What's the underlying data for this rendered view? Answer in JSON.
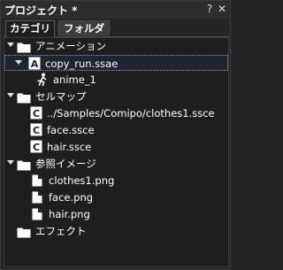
{
  "panel": {
    "title": "プロジェクト *",
    "help_glyph": "?",
    "close_glyph": "✕"
  },
  "tabs": [
    {
      "label": "カテゴリ",
      "active": true
    },
    {
      "label": "フォルダ",
      "active": false
    }
  ],
  "tree": {
    "anime_folder": {
      "label": "アニメーション",
      "icon": "folder-icon"
    },
    "copy_run": {
      "label": "copy_run.ssae",
      "icon": "animation-file-icon",
      "icon_letter": "A",
      "selected": true
    },
    "anime_1": {
      "label": "anime_1",
      "icon": "running-figure-icon"
    },
    "cellmap_folder": {
      "label": "セルマップ",
      "icon": "folder-icon"
    },
    "clothes1_ssce": {
      "label": "../Samples/Comipo/clothes1.ssce",
      "icon": "cellmap-file-icon",
      "icon_letter": "C"
    },
    "face_ssce": {
      "label": "face.ssce",
      "icon": "cellmap-file-icon",
      "icon_letter": "C"
    },
    "hair_ssce": {
      "label": "hair.ssce",
      "icon": "cellmap-file-icon",
      "icon_letter": "C"
    },
    "image_folder": {
      "label": "参照イメージ",
      "icon": "folder-icon"
    },
    "clothes1_png": {
      "label": "clothes1.png",
      "icon": "image-file-icon"
    },
    "face_png": {
      "label": "face.png",
      "icon": "image-file-icon"
    },
    "hair_png": {
      "label": "hair.png",
      "icon": "image-file-icon"
    },
    "effect_folder": {
      "label": "エフェクト",
      "icon": "folder-icon"
    }
  }
}
